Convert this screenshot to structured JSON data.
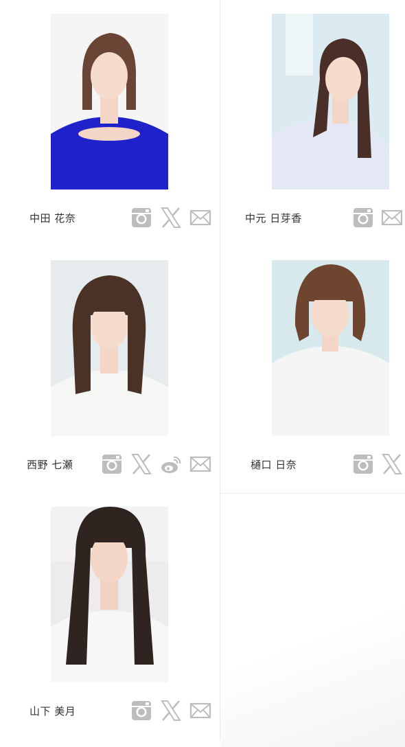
{
  "members": [
    {
      "name": "中田 花奈",
      "dress": "#1f22c9",
      "bg": "#f5f5f5",
      "hair": "#6a4535"
    },
    {
      "name": "中元 日芽香",
      "dress": "#e4e8f4",
      "bg": "#dcebf2",
      "hair": "#4a2f28"
    },
    {
      "name": "西野 七瀬",
      "dress": "#f6f6f4",
      "bg": "#e6ecee",
      "hair": "#4a3226"
    },
    {
      "name": "樋口 日奈",
      "dress": "#f4f6f6",
      "bg": "#d7e9ec",
      "hair": "#6e4630"
    },
    {
      "name": "山下 美月",
      "dress": "#f7f7f7",
      "bg": "#ececec",
      "hair": "#2f2420"
    }
  ],
  "icons": {
    "instagram": "instagram-icon",
    "x": "x-icon",
    "weibo": "weibo-icon",
    "mail": "mail-icon"
  },
  "colors": {
    "icon": "#bdbdbd",
    "divider": "#ececec",
    "text": "#333333"
  }
}
